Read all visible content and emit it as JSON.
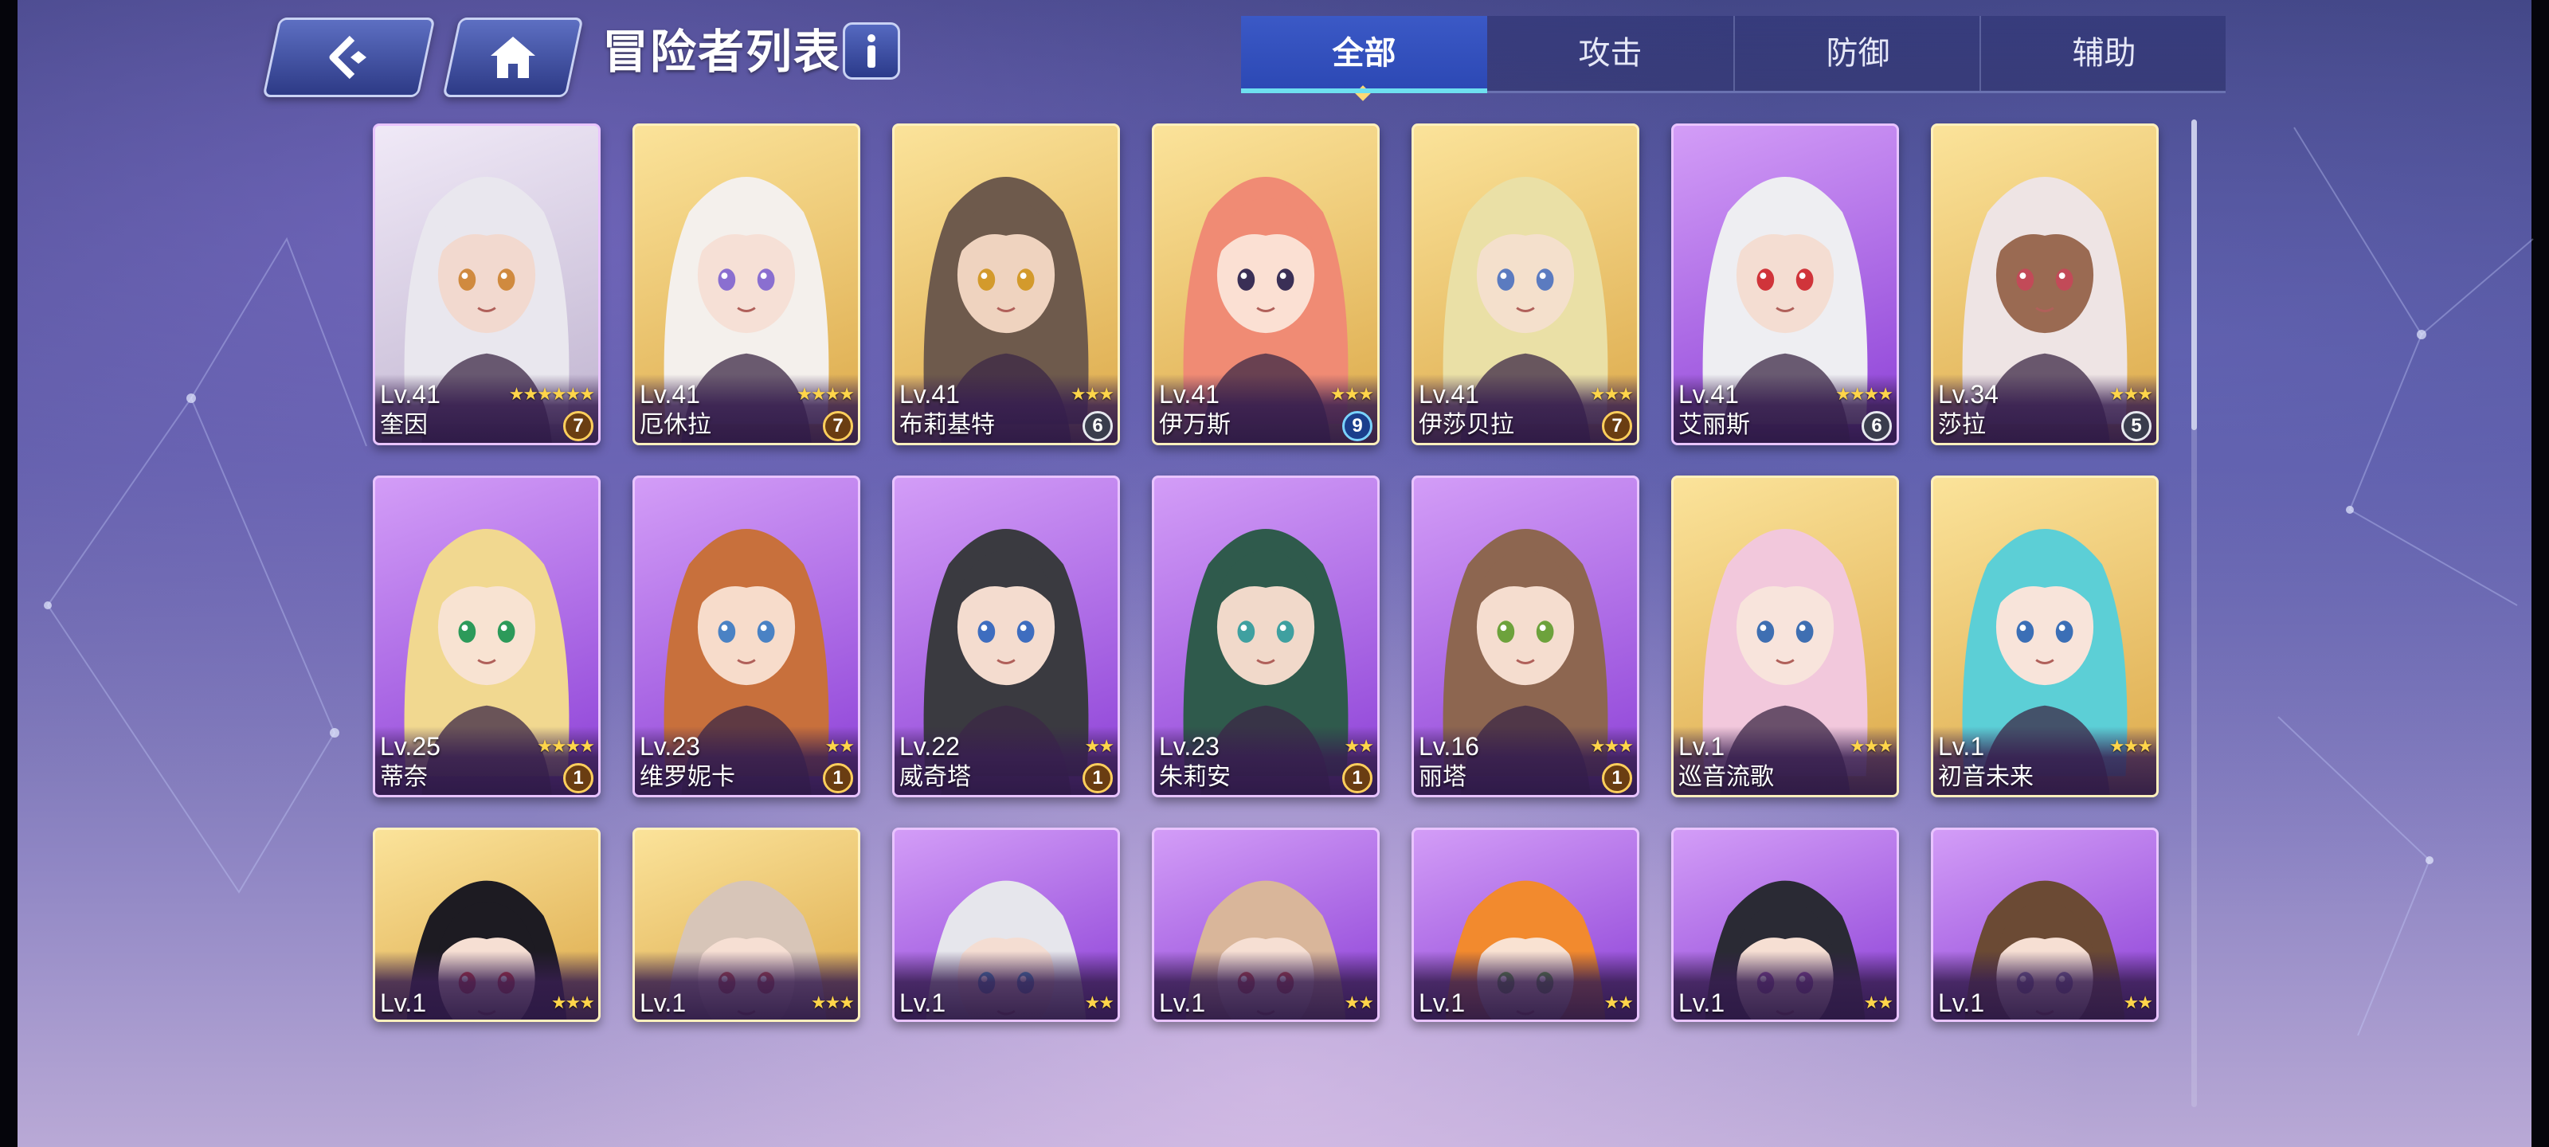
{
  "header": {
    "title": "冒险者列表"
  },
  "tabs": [
    "全部",
    "攻击",
    "防御",
    "辅助"
  ],
  "active_tab": 0,
  "star_glyph": "★",
  "cards": [
    {
      "level": "Lv.41",
      "name": "奎因",
      "stars": 6,
      "badge": "7",
      "frame": "white",
      "hair": "#e9e7ee",
      "skin": "#f2d9cf",
      "eye": "#d08a3f"
    },
    {
      "level": "Lv.41",
      "name": "厄休拉",
      "stars": 4,
      "badge": "7",
      "frame": "gold",
      "hair": "#f4f0ec",
      "skin": "#f6e0d6",
      "eye": "#8a6fd0"
    },
    {
      "level": "Lv.41",
      "name": "布莉基特",
      "stars": 3,
      "badge": "6",
      "frame": "gold",
      "hair": "#6e5a4c",
      "skin": "#efd3bf",
      "eye": "#d39a2c"
    },
    {
      "level": "Lv.41",
      "name": "伊万斯",
      "stars": 3,
      "badge": "9",
      "frame": "gold",
      "hair": "#f08b74",
      "skin": "#fbe0d3",
      "eye": "#3a2f56"
    },
    {
      "level": "Lv.41",
      "name": "伊莎贝拉",
      "stars": 3,
      "badge": "7",
      "frame": "gold",
      "hair": "#eae0a6",
      "skin": "#f4e0cc",
      "eye": "#5b7bc0"
    },
    {
      "level": "Lv.41",
      "name": "艾丽斯",
      "stars": 4,
      "badge": "6",
      "frame": "purple",
      "hair": "#eeeef2",
      "skin": "#f4ddd2",
      "eye": "#d0343a"
    },
    {
      "level": "Lv.34",
      "name": "莎拉",
      "stars": 3,
      "badge": "5",
      "frame": "gold",
      "hair": "#eee4e4",
      "skin": "#9a6a52",
      "eye": "#c24a58"
    },
    {
      "level": "Lv.25",
      "name": "蒂奈",
      "stars": 4,
      "badge": "1",
      "frame": "purple",
      "hair": "#f1d890",
      "skin": "#f8e3d2",
      "eye": "#2c9a5a"
    },
    {
      "level": "Lv.23",
      "name": "维罗妮卡",
      "stars": 2,
      "badge": "1",
      "frame": "purple",
      "hair": "#c8703c",
      "skin": "#f7dccb",
      "eye": "#4a82c4"
    },
    {
      "level": "Lv.22",
      "name": "威奇塔",
      "stars": 2,
      "badge": "1",
      "frame": "purple",
      "hair": "#3a3a40",
      "skin": "#f4dccf",
      "eye": "#3e6dbf"
    },
    {
      "level": "Lv.23",
      "name": "朱莉安",
      "stars": 2,
      "badge": "1",
      "frame": "purple",
      "hair": "#2f5a4c",
      "skin": "#f1d9ca",
      "eye": "#3fa0a0"
    },
    {
      "level": "Lv.16",
      "name": "丽塔",
      "stars": 3,
      "badge": "1",
      "frame": "purple",
      "hair": "#8d6650",
      "skin": "#f5ddcf",
      "eye": "#6da23c"
    },
    {
      "level": "Lv.1",
      "name": "巡音流歌",
      "stars": 3,
      "badge": "",
      "frame": "gold",
      "hair": "#f2c8dc",
      "skin": "#f8e4dc",
      "eye": "#3f6fb2"
    },
    {
      "level": "Lv.1",
      "name": "初音未来",
      "stars": 3,
      "badge": "",
      "frame": "gold",
      "hair": "#5ccfd6",
      "skin": "#f8e4da",
      "eye": "#3b6fb6"
    },
    {
      "level": "Lv.1",
      "name": "",
      "stars": 3,
      "badge": "",
      "frame": "gold",
      "hair": "#1d1b22",
      "skin": "#f6dfd3",
      "eye": "#d0343a"
    },
    {
      "level": "Lv.1",
      "name": "",
      "stars": 3,
      "badge": "",
      "frame": "gold",
      "hair": "#d7c5b8",
      "skin": "#f6dfd3",
      "eye": "#c04a4a"
    },
    {
      "level": "Lv.1",
      "name": "",
      "stars": 2,
      "badge": "",
      "frame": "purple",
      "hair": "#e6e6ec",
      "skin": "#f4ddd2",
      "eye": "#3f8cc0"
    },
    {
      "level": "Lv.1",
      "name": "",
      "stars": 2,
      "badge": "",
      "frame": "purple",
      "hair": "#d9b69a",
      "skin": "#f6dfd3",
      "eye": "#c04444"
    },
    {
      "level": "Lv.1",
      "name": "",
      "stars": 2,
      "badge": "",
      "frame": "purple",
      "hair": "#f28a2e",
      "skin": "#f9e2d2",
      "eye": "#5aa03c"
    },
    {
      "level": "Lv.1",
      "name": "",
      "stars": 2,
      "badge": "",
      "frame": "purple",
      "hair": "#2a2a34",
      "skin": "#f6dfd3",
      "eye": "#8a4aa0"
    },
    {
      "level": "Lv.1",
      "name": "",
      "stars": 2,
      "badge": "",
      "frame": "purple",
      "hair": "#6b4a34",
      "skin": "#f6dfd3",
      "eye": "#7a6aa0"
    }
  ]
}
